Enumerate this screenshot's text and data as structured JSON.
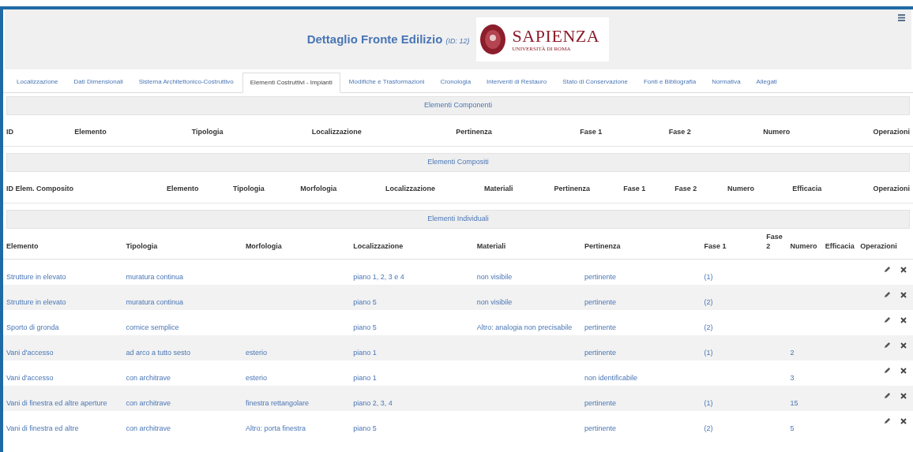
{
  "header": {
    "title": "Dettaglio Fronte Edilizio",
    "title_note": "(ID: 12)",
    "logo": {
      "name": "SAPIENZA",
      "subtitle": "UNIVERSITÀ DI ROMA"
    }
  },
  "tabs": [
    {
      "label": "Localizzazione",
      "selected": false
    },
    {
      "label": "Dati Dimensionali",
      "selected": false
    },
    {
      "label": "Sistema Architettonico-Costruttivo",
      "selected": false
    },
    {
      "label": "Elementi Costruttivi - Impianti",
      "selected": true
    },
    {
      "label": "Modifiche e Trasformazioni",
      "selected": false
    },
    {
      "label": "Cronologia",
      "selected": false
    },
    {
      "label": "Interventi di Restauro",
      "selected": false
    },
    {
      "label": "Stato di Conservazione",
      "selected": false
    },
    {
      "label": "Fonti e Bibliografia",
      "selected": false
    },
    {
      "label": "Normativa",
      "selected": false
    },
    {
      "label": "Allegati",
      "selected": false
    }
  ],
  "sections": [
    {
      "title": "Elementi Componenti",
      "columns": [
        "ID",
        "Elemento",
        "Tipologia",
        "Localizzazione",
        "Pertinenza",
        "Fase 1",
        "Fase 2",
        "Numero",
        "Operazioni"
      ]
    },
    {
      "title": "Elementi Compositi",
      "columns": [
        "ID Elem. Composito",
        "Elemento",
        "Tipologia",
        "Morfologia",
        "Localizzazione",
        "Materiali",
        "Pertinenza",
        "Fase 1",
        "Fase 2",
        "Numero",
        "Efficacia",
        "Operazioni"
      ]
    },
    {
      "title": "Elementi Individuali",
      "columns": [
        "Elemento",
        "Tipologia",
        "Morfologia",
        "Localizzazione",
        "Materiali",
        "Pertinenza",
        "Fase 1",
        "Fase 2",
        "Numero",
        "Efficacia",
        "Operazioni"
      ],
      "rows": [
        {
          "cells": [
            "Strutture in elevato",
            "muratura continua",
            null,
            "piano 1, 2, 3 e 4",
            "non visibile",
            "pertinente",
            "(1)",
            null,
            null,
            null
          ]
        },
        {
          "cells": [
            "Strutture in elevato",
            "muratura continua",
            null,
            "piano 5",
            "non visibile",
            "pertinente",
            "(2)",
            null,
            null,
            null
          ]
        },
        {
          "cells": [
            "Sporto di gronda",
            "cornice semplice",
            null,
            "piano 5",
            "Altro: analogia non precisabile",
            "pertinente",
            "(2)",
            null,
            null,
            null
          ]
        },
        {
          "cells": [
            "Vani d'accesso",
            "ad arco a tutto sesto",
            "esterio",
            "piano 1",
            null,
            "pertinente",
            "(1)",
            null,
            "2",
            null
          ]
        },
        {
          "cells": [
            "Vani d'accesso",
            "con architrave",
            "esterio",
            "piano 1",
            null,
            "non identificabile",
            null,
            null,
            "3",
            null
          ]
        },
        {
          "cells": [
            "Vani di finestra ed altre aperture",
            "con architrave",
            "finestra rettangolare",
            "piano 2, 3, 4",
            null,
            "pertinente",
            "(1)",
            null,
            "15",
            null
          ]
        },
        {
          "cells": [
            "Vani di finestra ed altre",
            "con architrave",
            "Altro: porta finestra",
            "piano 5",
            null,
            "pertinente",
            "(2)",
            null,
            "5",
            null
          ]
        }
      ]
    }
  ]
}
